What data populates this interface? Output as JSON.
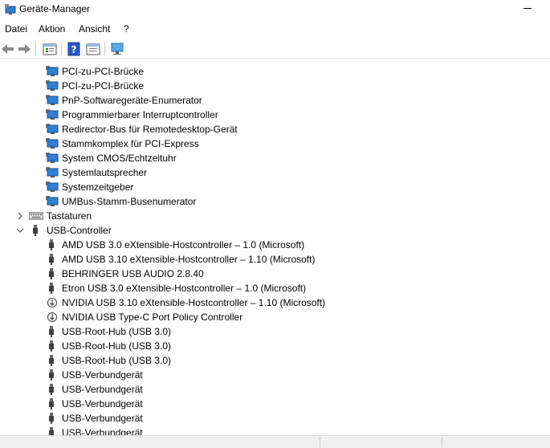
{
  "window": {
    "title": "Geräte-Manager"
  },
  "menu": {
    "items": [
      "Datei",
      "Aktion",
      "Ansicht",
      "?"
    ]
  },
  "toolbar": {
    "buttons": [
      "back-icon",
      "forward-icon",
      "properties-icon",
      "help-icon",
      "show-hidden-icon",
      "scan-hardware-icon"
    ]
  },
  "tree": {
    "system_devices_children": [
      "PCI-zu-PCI-Brücke",
      "PCI-zu-PCI-Brücke",
      "PnP-Softwaregeräte-Enumerator",
      "Programmierbarer Interruptcontroller",
      "Redirector-Bus für Remotedesktop-Gerät",
      "Stammkomplex für PCI-Express",
      "System CMOS/Echtzeituhr",
      "Systemlautsprecher",
      "Systemzeitgeber",
      "UMBus-Stamm-Busenumerator"
    ],
    "keyboards": {
      "label": "Tastaturen",
      "expanded": false
    },
    "usb": {
      "label": "USB-Controller",
      "expanded": true,
      "children": [
        "AMD USB 3.0 eXtensible-Hostcontroller – 1.0 (Microsoft)",
        "AMD USB 3.10 eXtensible-Hostcontroller – 1.10 (Microsoft)",
        "BEHRINGER USB AUDIO 2.8.40",
        "Etron USB 3.0 eXtensible-Hostcontroller – 1.0 (Microsoft)",
        "NVIDIA USB 3.10 eXtensible-Hostcontroller – 1.10 (Microsoft)",
        "NVIDIA USB Type-C Port Policy Controller",
        "USB-Root-Hub (USB 3.0)",
        "USB-Root-Hub (USB 3.0)",
        "USB-Root-Hub (USB 3.0)",
        "USB-Verbundgerät",
        "USB-Verbundgerät",
        "USB-Verbundgerät",
        "USB-Verbundgerät",
        "USB-Verbundgerät"
      ],
      "special_icon_indices": [
        4,
        5
      ]
    }
  },
  "colors": {
    "monitor_blue": "#2f7fd6",
    "icon_dark": "#404040",
    "help_blue": "#2a56c6"
  }
}
